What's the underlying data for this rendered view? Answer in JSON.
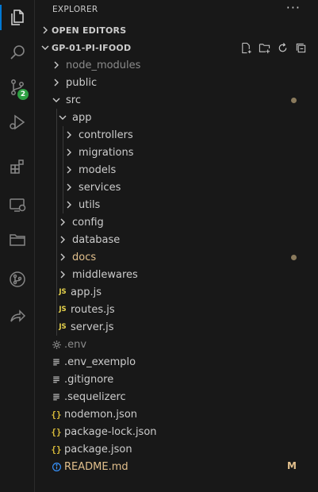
{
  "activity_bar": {
    "items": [
      {
        "name": "explorer",
        "icon": "files-icon",
        "active": true
      },
      {
        "name": "search",
        "icon": "search-icon"
      },
      {
        "name": "source-control",
        "icon": "source-control-icon",
        "badge": "2"
      },
      {
        "name": "run-debug",
        "icon": "run-debug-icon"
      },
      {
        "name": "extensions",
        "icon": "extensions-icon"
      },
      {
        "name": "remote-explorer",
        "icon": "remote-explorer-icon"
      },
      {
        "name": "project-manager",
        "icon": "folder-icon"
      },
      {
        "name": "git-graph",
        "icon": "git-graph-icon"
      },
      {
        "name": "live-share",
        "icon": "live-share-icon"
      }
    ]
  },
  "explorer": {
    "title": "EXPLORER",
    "more_actions": "···",
    "open_editors_label": "OPEN EDITORS",
    "project_label": "GP-01-PI-IFOOD",
    "tree": [
      {
        "label": "node_modules",
        "type": "folder",
        "state": "collapsed",
        "depth": 0,
        "style": "dim"
      },
      {
        "label": "public",
        "type": "folder",
        "state": "collapsed",
        "depth": 0
      },
      {
        "label": "src",
        "type": "folder",
        "state": "expanded",
        "depth": 0,
        "decoration": "dot"
      },
      {
        "label": "app",
        "type": "folder",
        "state": "expanded",
        "depth": 1
      },
      {
        "label": "controllers",
        "type": "folder",
        "state": "collapsed",
        "depth": 2
      },
      {
        "label": "migrations",
        "type": "folder",
        "state": "collapsed",
        "depth": 2
      },
      {
        "label": "models",
        "type": "folder",
        "state": "collapsed",
        "depth": 2
      },
      {
        "label": "services",
        "type": "folder",
        "state": "collapsed",
        "depth": 2
      },
      {
        "label": "utils",
        "type": "folder",
        "state": "collapsed",
        "depth": 2
      },
      {
        "label": "config",
        "type": "folder",
        "state": "collapsed",
        "depth": 1
      },
      {
        "label": "database",
        "type": "folder",
        "state": "collapsed",
        "depth": 1
      },
      {
        "label": "docs",
        "type": "folder",
        "state": "collapsed",
        "depth": 1,
        "style": "modified",
        "decoration": "dot"
      },
      {
        "label": "middlewares",
        "type": "folder",
        "state": "collapsed",
        "depth": 1
      },
      {
        "label": "app.js",
        "type": "js",
        "depth": 1,
        "icon_text": "JS"
      },
      {
        "label": "routes.js",
        "type": "js",
        "depth": 1,
        "icon_text": "JS"
      },
      {
        "label": "server.js",
        "type": "js",
        "depth": 1,
        "icon_text": "JS"
      },
      {
        "label": ".env",
        "type": "gear",
        "depth": 0,
        "style": "dim"
      },
      {
        "label": ".env_exemplo",
        "type": "lines",
        "depth": 0
      },
      {
        "label": ".gitignore",
        "type": "lines",
        "depth": 0
      },
      {
        "label": ".sequelizerc",
        "type": "lines",
        "depth": 0
      },
      {
        "label": "nodemon.json",
        "type": "json",
        "depth": 0,
        "icon_text": "{}"
      },
      {
        "label": "package-lock.json",
        "type": "json",
        "depth": 0,
        "icon_text": "{}"
      },
      {
        "label": "package.json",
        "type": "json",
        "depth": 0,
        "icon_text": "{}"
      },
      {
        "label": "README.md",
        "type": "info",
        "depth": 0,
        "style": "modified",
        "decoration": "letter",
        "decoration_text": "M"
      }
    ]
  },
  "colors": {
    "background": "#181818",
    "text": "#cccccc",
    "dim_text": "#8b8b8b",
    "modified": "#e2c08d",
    "badge": "#2ea043",
    "js_icon": "#e8d44d",
    "json_icon": "#d7ba3a",
    "info_icon": "#3794ff"
  }
}
